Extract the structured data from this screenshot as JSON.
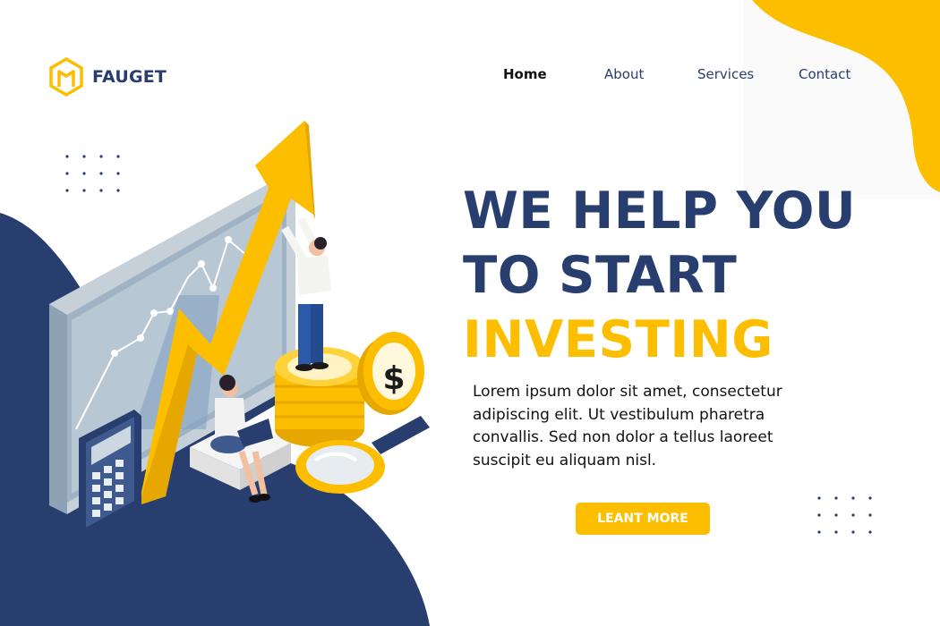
{
  "brand": {
    "name": "FAUGET",
    "logo_icon": "hexagon-m-logo-icon"
  },
  "nav": {
    "items": [
      {
        "label": "Home",
        "active": true
      },
      {
        "label": "About",
        "active": false
      },
      {
        "label": "Services",
        "active": false
      },
      {
        "label": "Contact",
        "active": false
      }
    ]
  },
  "hero": {
    "line1": "WE HELP YOU",
    "line2": "TO START",
    "line3": "INVESTING",
    "body": "Lorem ipsum dolor sit amet, consectetur adipiscing elit. Ut vestibulum pharetra convallis. Sed non dolor a tellus laoreet suscipit eu aliquam nisl.",
    "cta_label": "LEANT MORE"
  },
  "illustration": {
    "name": "investment-growth-illustration",
    "coin_symbol": "$"
  },
  "colors": {
    "navy": "#283e6e",
    "yellow": "#fdbe00",
    "white": "#ffffff"
  }
}
